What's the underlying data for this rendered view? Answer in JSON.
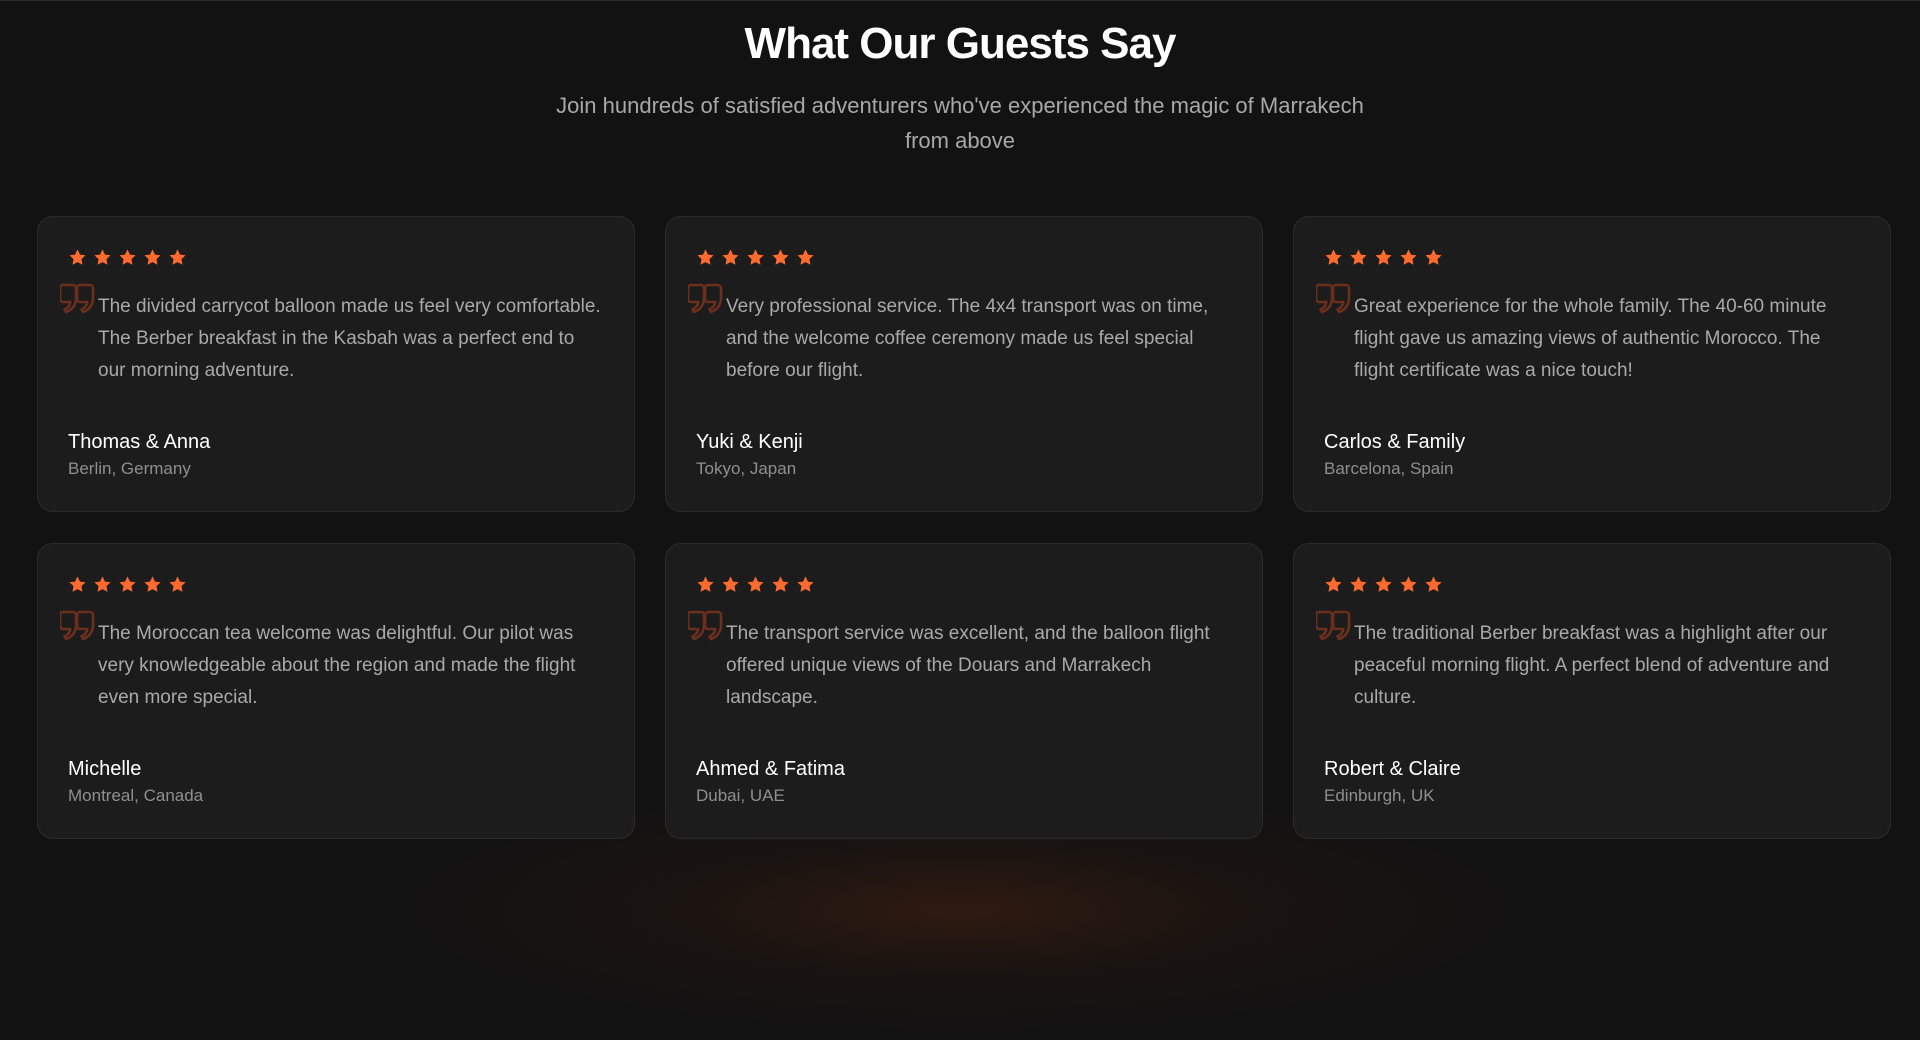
{
  "section": {
    "title": "What Our Guests Say",
    "subtitle": "Join hundreds of satisfied adventurers who've experienced the magic of Marrakech from above"
  },
  "colors": {
    "background": "#121212",
    "card": "#1c1c1c",
    "star": "#ff6a2e",
    "quote_mark": "#6b2f1c",
    "text": "#a9a9a9",
    "name": "#ffffff",
    "location": "#8f8f8f"
  },
  "icons": {
    "star": "star-icon",
    "quote": "quote-icon"
  },
  "testimonials": [
    {
      "rating": 5,
      "text": "The divided carrycot balloon made us feel very comfortable. The Berber breakfast in the Kasbah was a perfect end to our morning adventure.",
      "name": "Thomas & Anna",
      "location": "Berlin, Germany"
    },
    {
      "rating": 5,
      "text": "Very professional service. The 4x4 transport was on time, and the welcome coffee ceremony made us feel special before our flight.",
      "name": "Yuki & Kenji",
      "location": "Tokyo, Japan"
    },
    {
      "rating": 5,
      "text": "Great experience for the whole family. The 40-60 minute flight gave us amazing views of authentic Morocco. The flight certificate was a nice touch!",
      "name": "Carlos & Family",
      "location": "Barcelona, Spain"
    },
    {
      "rating": 5,
      "text": "The Moroccan tea welcome was delightful. Our pilot was very knowledgeable about the region and made the flight even more special.",
      "name": "Michelle",
      "location": "Montreal, Canada"
    },
    {
      "rating": 5,
      "text": "The transport service was excellent, and the balloon flight offered unique views of the Douars and Marrakech landscape.",
      "name": "Ahmed & Fatima",
      "location": "Dubai, UAE"
    },
    {
      "rating": 5,
      "text": "The traditional Berber breakfast was a highlight after our peaceful morning flight. A perfect blend of adventure and culture.",
      "name": "Robert & Claire",
      "location": "Edinburgh, UK"
    }
  ]
}
